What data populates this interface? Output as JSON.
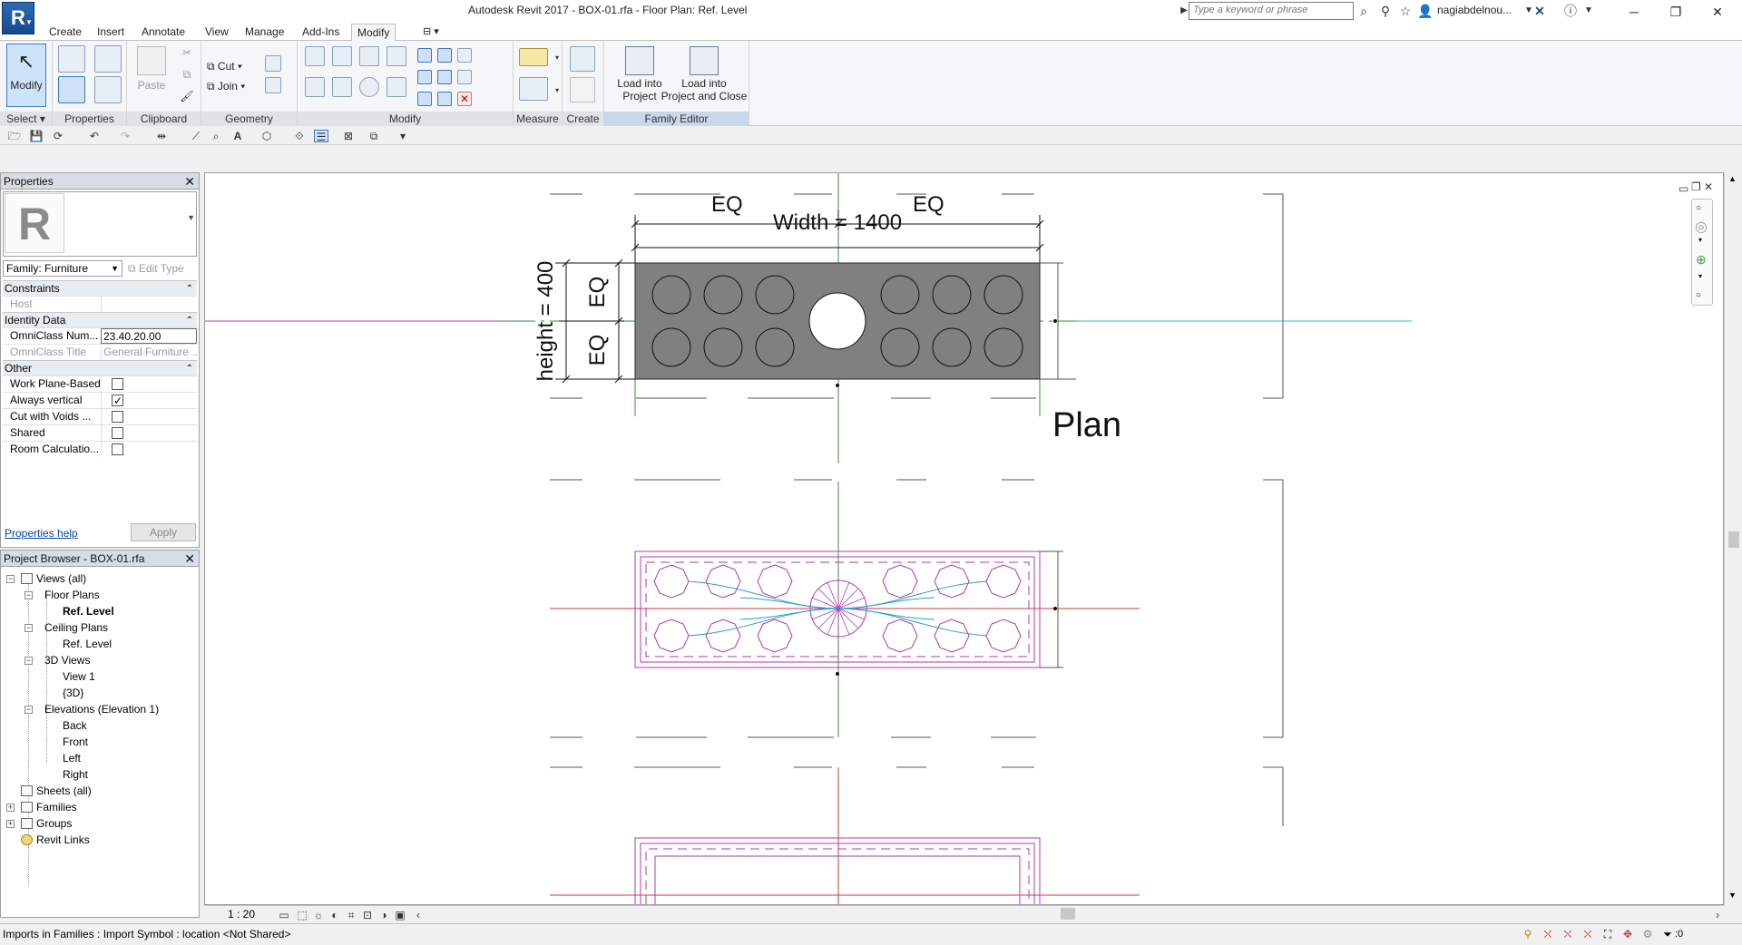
{
  "title_bar": {
    "title": "Autodesk Revit 2017 -    BOX-01.rfa - Floor Plan: Ref. Level",
    "search_placeholder": "Type a keyword or phrase",
    "user": "nagiabdelnou...",
    "app_letter": "R"
  },
  "ribbon_tabs": [
    "Create",
    "Insert",
    "Annotate",
    "View",
    "Manage",
    "Add-Ins",
    "Modify"
  ],
  "ribbon": {
    "modify_label": "Modify",
    "select_label": "Select",
    "properties_label": "Properties",
    "paste_label": "Paste",
    "cut_label": "Cut",
    "join_label": "Join",
    "clipboard_label": "Clipboard",
    "geometry_label": "Geometry",
    "modify_panel_label": "Modify",
    "measure_label": "Measure",
    "create_label": "Create",
    "load_into_project": [
      "Load into",
      "Project"
    ],
    "load_into_project_close": [
      "Load into",
      "Project and Close"
    ],
    "family_editor_label": "Family Editor"
  },
  "properties": {
    "header": "Properties",
    "type_letter": "R",
    "family_select": "Family: Furniture",
    "edit_type": "Edit Type",
    "sections": {
      "constraints": "Constraints",
      "identity": "Identity Data",
      "other": "Other"
    },
    "rows": {
      "host": "Host",
      "omniclass_num": "OmniClass Num...",
      "omniclass_num_value": "23.40.20.00",
      "omniclass_title": "OmniClass Title",
      "omniclass_title_value": "General Furniture ...",
      "work_plane": "Work Plane-Based",
      "always_vertical": "Always vertical",
      "cut_with_voids": "Cut with Voids ...",
      "shared": "Shared",
      "room_calc": "Room Calculatio..."
    },
    "help_link": "Properties help",
    "apply": "Apply"
  },
  "browser": {
    "header": "Project Browser - BOX-01.rfa",
    "items": {
      "views_all": "Views (all)",
      "floor_plans": "Floor Plans",
      "ref_level_fp": "Ref. Level",
      "ceiling_plans": "Ceiling Plans",
      "ref_level_cp": "Ref. Level",
      "views_3d": "3D Views",
      "view1": "View 1",
      "view3d": "{3D}",
      "elevations": "Elevations (Elevation 1)",
      "back": "Back",
      "front": "Front",
      "left": "Left",
      "right": "Right",
      "sheets": "Sheets (all)",
      "families": "Families",
      "groups": "Groups",
      "revit_links": "Revit Links"
    }
  },
  "drawing": {
    "eq_left": "EQ",
    "eq_right": "EQ",
    "width_dim": "Width = 1400",
    "height_dim": "height = 400",
    "eq_top": "EQ",
    "eq_bottom": "EQ",
    "plan_label": "Plan"
  },
  "view_control": {
    "scale": "1 : 20"
  },
  "status": {
    "text": "Imports in Families : Import Symbol : location <Not Shared>",
    "filter_count": ":0"
  }
}
